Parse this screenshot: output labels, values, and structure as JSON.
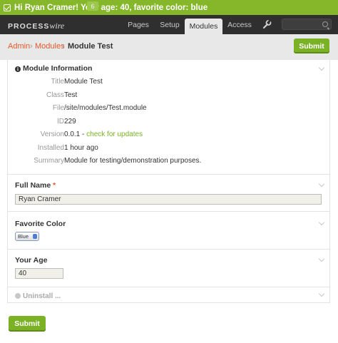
{
  "notice": {
    "message": "Hi Ryan Cramer! Your age: 40, favorite color: blue",
    "count": "6"
  },
  "masthead": {
    "logo_main": "PROCESS",
    "logo_script": "wire",
    "nav": [
      "Pages",
      "Setup",
      "Modules",
      "Access"
    ],
    "active_nav": "Modules",
    "search_placeholder": ""
  },
  "header": {
    "breadcrumbs": [
      "Admin",
      "Modules"
    ],
    "separator": "›",
    "title": "Module Test",
    "submit_label": "Submit"
  },
  "module_info": {
    "heading": "Module Information",
    "rows": [
      {
        "key": "Title",
        "value": "Module Test"
      },
      {
        "key": "Class",
        "value": "Test"
      },
      {
        "key": "File",
        "value": "/site/modules/Test.module"
      },
      {
        "key": "ID",
        "value": "229"
      },
      {
        "key": "Version",
        "value": "0.0.1 - ",
        "link": "check for updates"
      },
      {
        "key": "Installed",
        "value": "1 hour ago"
      },
      {
        "key": "Summary",
        "value": "Module for testing/demonstration purposes."
      }
    ]
  },
  "fields": {
    "full_name": {
      "label": "Full Name",
      "required_mark": "*",
      "value": "Ryan Cramer"
    },
    "favorite_color": {
      "label": "Favorite Color",
      "selected": "Blue"
    },
    "your_age": {
      "label": "Your Age",
      "value": "40"
    }
  },
  "uninstall": {
    "label": "Uninstall ..."
  },
  "footer": {
    "submit_label": "Submit"
  },
  "colors": {
    "accent_green": "#7bb225",
    "notice_green": "#86b72a",
    "link_orange": "#e05a2b",
    "masthead_dark": "#2f2f2f"
  }
}
